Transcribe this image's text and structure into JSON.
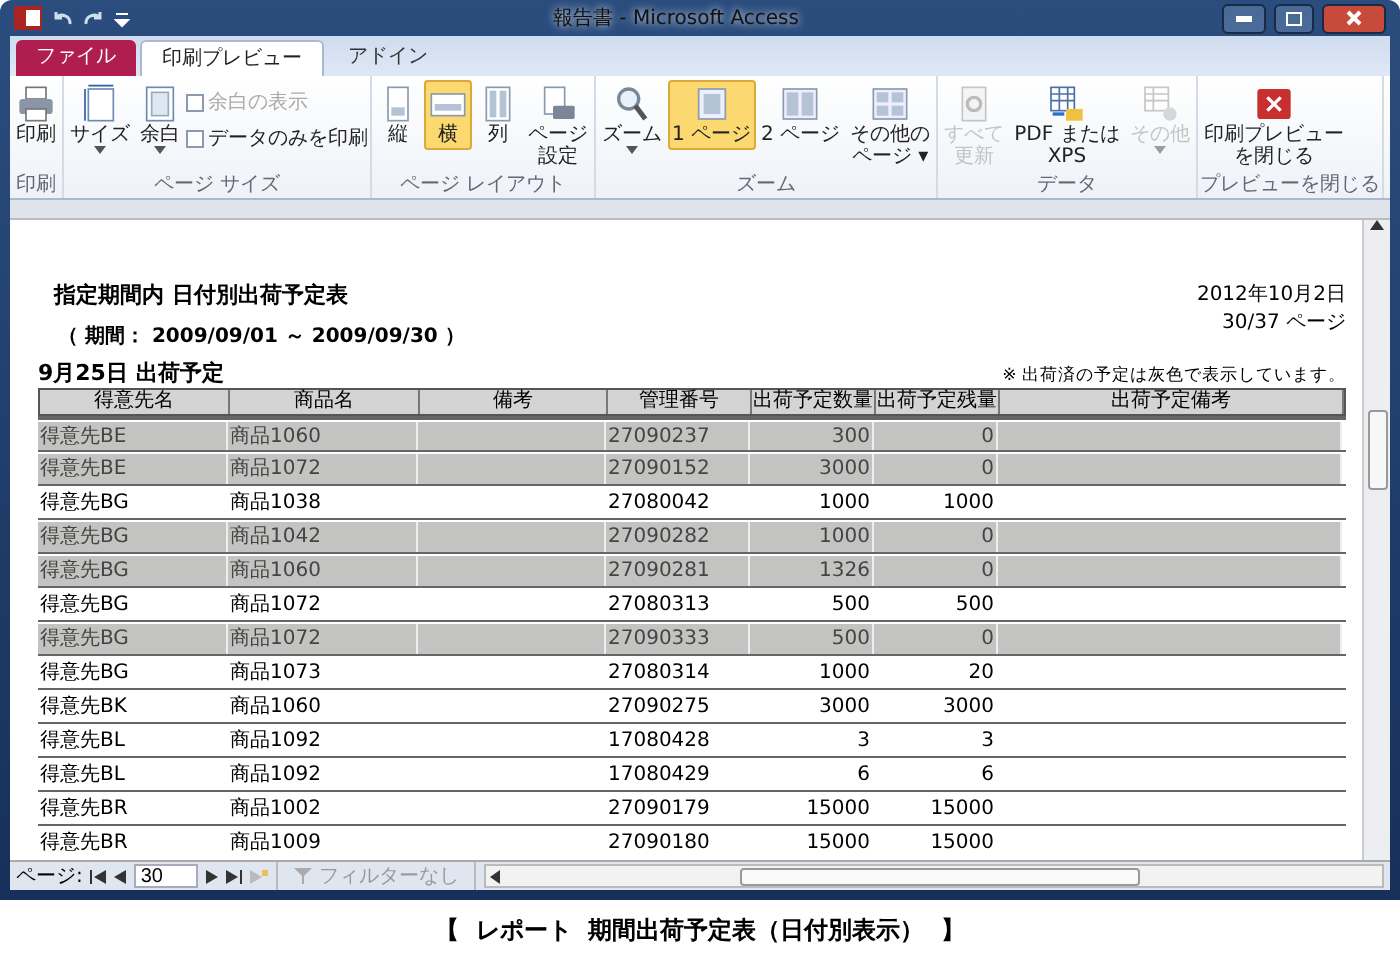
{
  "window": {
    "title": "報告書 - Microsoft Access"
  },
  "tabs": [
    {
      "label": "ファイル",
      "kind": "file",
      "selected": false
    },
    {
      "label": "印刷プレビュー",
      "kind": "tab",
      "selected": true
    },
    {
      "label": "アドイン",
      "kind": "tab",
      "selected": false
    }
  ],
  "ribbon": [
    {
      "label": "印刷",
      "items": [
        {
          "kind": "big",
          "lines": [
            "印刷"
          ],
          "dropdown": false,
          "selected": false,
          "disabled": false
        }
      ]
    },
    {
      "label": "ページ サイズ",
      "items": [
        {
          "kind": "big",
          "lines": [
            "サイズ"
          ],
          "dropdown": true,
          "selected": false,
          "disabled": false
        },
        {
          "kind": "big",
          "lines": [
            "余白"
          ],
          "dropdown": true,
          "selected": false,
          "disabled": false
        },
        {
          "kind": "checks",
          "checks": [
            {
              "label": "余白の表示",
              "checked": false,
              "disabled": true
            },
            {
              "label": "データのみを印刷",
              "checked": false,
              "disabled": false
            }
          ]
        }
      ]
    },
    {
      "label": "ページ レイアウト",
      "items": [
        {
          "kind": "big",
          "lines": [
            "縦"
          ],
          "dropdown": false,
          "selected": false,
          "disabled": false
        },
        {
          "kind": "big",
          "lines": [
            "横"
          ],
          "dropdown": false,
          "selected": true,
          "disabled": false
        },
        {
          "kind": "big",
          "lines": [
            "列"
          ],
          "dropdown": false,
          "selected": false,
          "disabled": false
        },
        {
          "kind": "big",
          "lines": [
            "ページ",
            "設定"
          ],
          "dropdown": false,
          "selected": false,
          "disabled": false
        }
      ]
    },
    {
      "label": "ズーム",
      "items": [
        {
          "kind": "big",
          "lines": [
            "ズーム"
          ],
          "dropdown": true,
          "selected": false,
          "disabled": false
        },
        {
          "kind": "big",
          "lines": [
            "1 ページ"
          ],
          "dropdown": false,
          "selected": true,
          "disabled": false
        },
        {
          "kind": "big",
          "lines": [
            "2 ページ"
          ],
          "dropdown": false,
          "selected": false,
          "disabled": false
        },
        {
          "kind": "big",
          "lines": [
            "その他の",
            "ページ ▾"
          ],
          "dropdown": false,
          "selected": false,
          "disabled": false
        }
      ]
    },
    {
      "label": "データ",
      "items": [
        {
          "kind": "big",
          "lines": [
            "すべて",
            "更新"
          ],
          "dropdown": false,
          "selected": false,
          "disabled": true
        },
        {
          "kind": "big",
          "lines": [
            "PDF または",
            "XPS"
          ],
          "dropdown": false,
          "selected": false,
          "disabled": false
        },
        {
          "kind": "big",
          "lines": [
            "その他"
          ],
          "dropdown": true,
          "selected": false,
          "disabled": true
        }
      ]
    },
    {
      "label": "プレビューを閉じる",
      "items": [
        {
          "kind": "big",
          "lines": [
            "印刷プレビュー",
            "を閉じる"
          ],
          "dropdown": false,
          "selected": false,
          "disabled": false
        }
      ]
    }
  ],
  "report": {
    "title": "指定期間内 日付別出荷予定表",
    "period": "（ 期間：  2009/09/01  ～  2009/09/30  ）",
    "date": "2012年10月2日",
    "page": "30/37 ページ",
    "section": "9月25日 出荷予定",
    "note": "※ 出荷済の予定は灰色で表示しています。",
    "columns": [
      "得意先名",
      "商品名",
      "備考",
      "管理番号",
      "出荷予定数量",
      "出荷予定残量",
      "出荷予定備考"
    ],
    "rows": [
      {
        "shipped": true,
        "cells": [
          "得意先BE",
          "商品1060",
          "",
          "27090237",
          "300",
          "0",
          ""
        ]
      },
      {
        "shipped": true,
        "cells": [
          "得意先BE",
          "商品1072",
          "",
          "27090152",
          "3000",
          "0",
          ""
        ]
      },
      {
        "shipped": false,
        "cells": [
          "得意先BG",
          "商品1038",
          "",
          "27080042",
          "1000",
          "1000",
          ""
        ]
      },
      {
        "shipped": true,
        "cells": [
          "得意先BG",
          "商品1042",
          "",
          "27090282",
          "1000",
          "0",
          ""
        ]
      },
      {
        "shipped": true,
        "cells": [
          "得意先BG",
          "商品1060",
          "",
          "27090281",
          "1326",
          "0",
          ""
        ]
      },
      {
        "shipped": false,
        "cells": [
          "得意先BG",
          "商品1072",
          "",
          "27080313",
          "500",
          "500",
          ""
        ]
      },
      {
        "shipped": true,
        "cells": [
          "得意先BG",
          "商品1072",
          "",
          "27090333",
          "500",
          "0",
          ""
        ]
      },
      {
        "shipped": false,
        "cells": [
          "得意先BG",
          "商品1073",
          "",
          "27080314",
          "1000",
          "20",
          ""
        ]
      },
      {
        "shipped": false,
        "cells": [
          "得意先BK",
          "商品1060",
          "",
          "27090275",
          "3000",
          "3000",
          ""
        ]
      },
      {
        "shipped": false,
        "cells": [
          "得意先BL",
          "商品1092",
          "",
          "17080428",
          "3",
          "3",
          ""
        ]
      },
      {
        "shipped": false,
        "cells": [
          "得意先BL",
          "商品1092",
          "",
          "17080429",
          "6",
          "6",
          ""
        ]
      },
      {
        "shipped": false,
        "cells": [
          "得意先BR",
          "商品1002",
          "",
          "27090179",
          "15000",
          "15000",
          ""
        ]
      },
      {
        "shipped": false,
        "cells": [
          "得意先BR",
          "商品1009",
          "",
          "27090180",
          "15000",
          "15000",
          ""
        ]
      }
    ]
  },
  "status": {
    "page_label": "ページ:",
    "page_value": "30",
    "filter": "フィルターなし"
  },
  "caption": "【  レポート  期間出荷予定表（日付別表示）  】"
}
